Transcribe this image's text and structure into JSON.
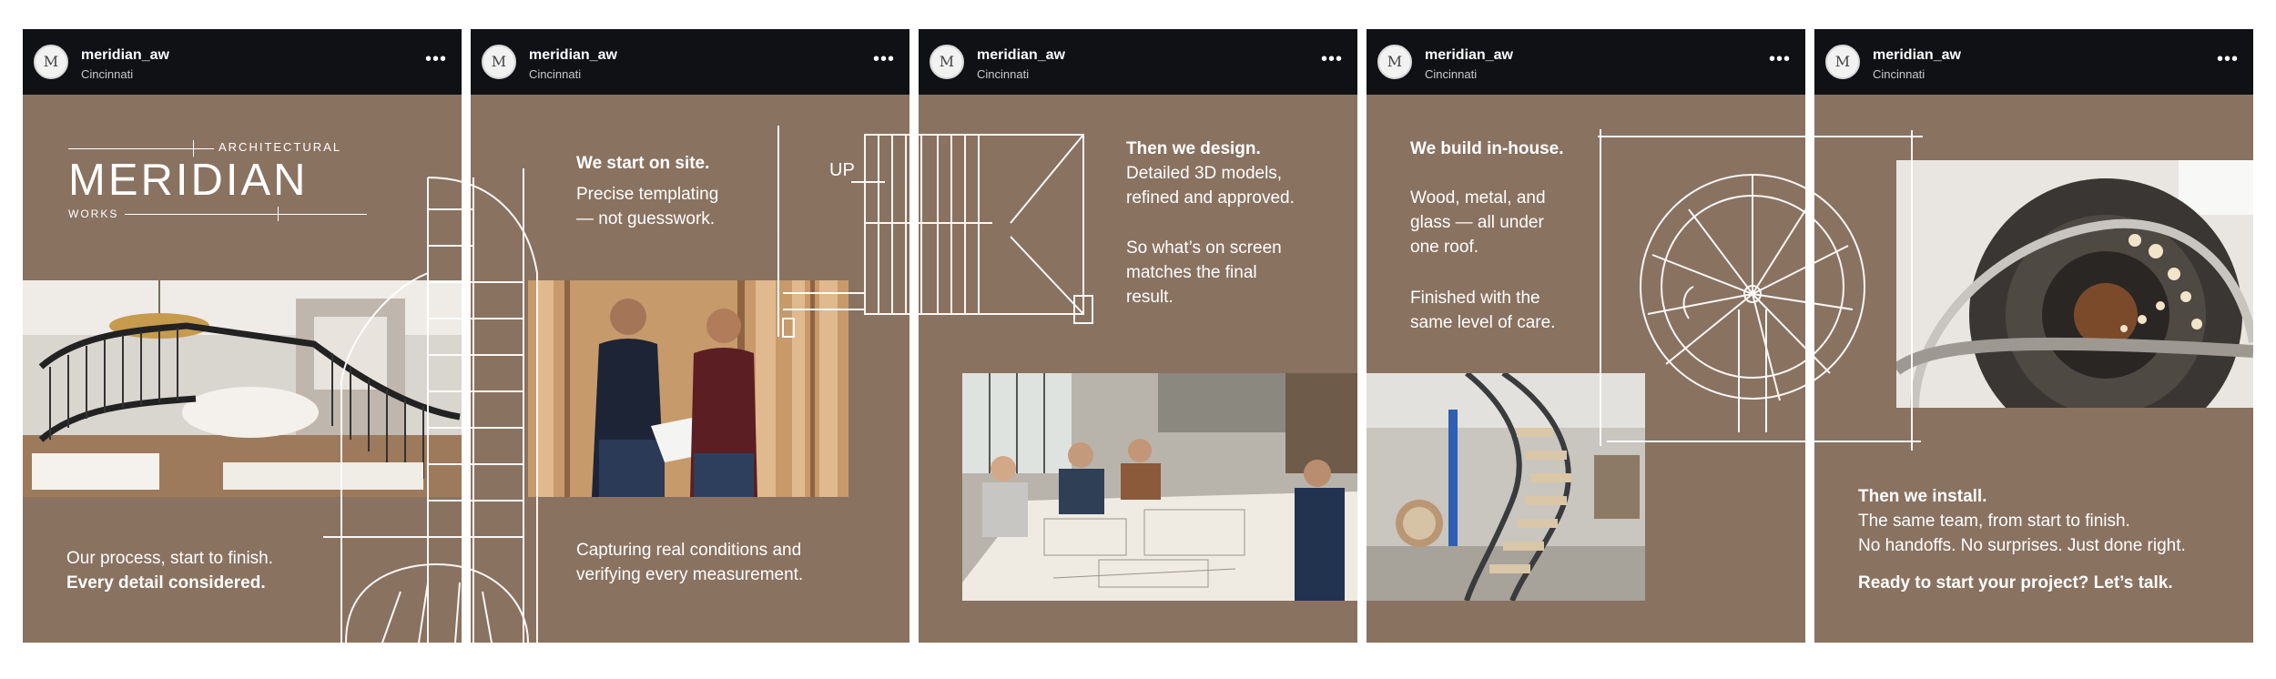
{
  "posts": [
    {
      "username": "meridian_aw",
      "location": "Cincinnati",
      "avatar_letter": "M",
      "more": "•••",
      "logo": {
        "top_word": "ARCHITECTURAL",
        "main": "MERIDIAN",
        "sub": "WORKS"
      },
      "caption_1": "Our process, start to finish.",
      "caption_2": "Every detail considered."
    },
    {
      "username": "meridian_aw",
      "location": "Cincinnati",
      "avatar_letter": "M",
      "more": "•••",
      "heading": "We start on site.",
      "body": "Precise templating\n— not guesswork.",
      "caption": "Capturing real conditions and\nverifying every measurement.",
      "sketch_label": "UP"
    },
    {
      "username": "meridian_aw",
      "location": "Cincinnati",
      "avatar_letter": "M",
      "more": "•••",
      "heading": "Then we design.",
      "body_1": "Detailed 3D models,\nrefined and approved.",
      "body_2": "So what’s on screen\nmatches the final\nresult."
    },
    {
      "username": "meridian_aw",
      "location": "Cincinnati",
      "avatar_letter": "M",
      "more": "•••",
      "heading": "We build in-house.",
      "body_1": "Wood, metal, and\nglass — all under\none roof.",
      "body_2": "Finished with the\nsame level of care."
    },
    {
      "username": "meridian_aw",
      "location": "Cincinnati",
      "avatar_letter": "M",
      "more": "•••",
      "heading": "Then we install.",
      "body": "The same team, from start to finish.\nNo handoffs. No surprises. Just done right.",
      "cta": "Ready to start your project? Let’s talk."
    }
  ],
  "colors": {
    "panel": "#8a7260",
    "header": "#0f1115",
    "text": "#ffffff"
  },
  "icons": [
    "more-options-icon",
    "avatar-logo-icon"
  ]
}
